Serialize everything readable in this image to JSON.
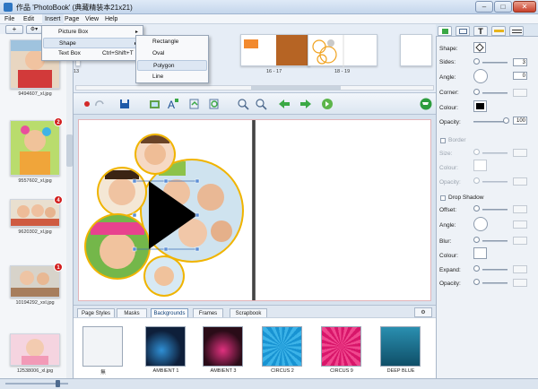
{
  "window": {
    "title": "作品 'PhotoBook' (典藏精装本21x21)",
    "min": "–",
    "max": "□",
    "close": "✕"
  },
  "menu": {
    "file": "File",
    "edit": "Edit",
    "insert": "Insert",
    "page": "Page",
    "view": "View",
    "help": "Help"
  },
  "insert_menu": {
    "items": [
      {
        "label": "Picture Box",
        "shortcut": "",
        "arrow": "▸"
      },
      {
        "label": "Shape",
        "shortcut": "",
        "arrow": "▸"
      },
      {
        "label": "Text Box",
        "shortcut": "Ctrl+Shift+T",
        "arrow": ""
      }
    ]
  },
  "shape_submenu": {
    "items": [
      "Rectangle",
      "Oval",
      "Polygon",
      "Line"
    ],
    "highlighted": "Polygon"
  },
  "left_toolbar": {
    "add": "+",
    "settings": "⚙▾"
  },
  "photos": [
    {
      "name": "9494607_xl.jpg",
      "badge": "1"
    },
    {
      "name": "9557602_xl.jpg",
      "badge": "2"
    },
    {
      "name": "9620302_xl.jpg",
      "badge": "4"
    },
    {
      "name": "10194292_xxl.jpg",
      "badge": "1"
    },
    {
      "name": "12538006_xl.jpg",
      "badge": ""
    }
  ],
  "spreads": [
    {
      "label": "13"
    },
    {
      "label": "16 - 17"
    },
    {
      "label": "18 - 19"
    }
  ],
  "bottom_tabs": [
    "Page Styles",
    "Masks",
    "Backgrounds",
    "Frames",
    "Scrapbook"
  ],
  "active_tab": "Backgrounds",
  "backgrounds": [
    {
      "label": "無",
      "color": "#f2f4f7"
    },
    {
      "label": "AMBIENT 1",
      "color": "#11243f"
    },
    {
      "label": "AMBIENT 3",
      "color": "#3a0f1f"
    },
    {
      "label": "CIRCUS 2",
      "color": "#1a9ad4"
    },
    {
      "label": "CIRCUS 9",
      "color": "#e0206f"
    },
    {
      "label": "DEEP BLUE",
      "color": "#1b6e8f"
    }
  ],
  "properties": {
    "shape_label": "Shape:",
    "sides_label": "Sides:",
    "sides_value": "3",
    "angle_label": "Angle:",
    "angle_value": "0",
    "corner_label": "Corner:",
    "colour_label": "Colour:",
    "opacity_label": "Opacity:",
    "opacity_value": "100",
    "border_label": "Border",
    "size_label": "Size:",
    "border_colour_label": "Colour:",
    "border_opacity_label": "Opacity:",
    "drop_shadow_label": "Drop Shadow",
    "offset_label": "Offset:",
    "ds_angle_label": "Angle:",
    "blur_label": "Blur:",
    "ds_colour_label": "Colour:",
    "expand_label": "Expand:",
    "ds_opacity_label": "Opacity:"
  },
  "colors": {
    "accent": "#f0b400",
    "shape_fill": "#000000",
    "titlebar": "#c4d6ec",
    "toolbar_green": "#3aa845"
  }
}
